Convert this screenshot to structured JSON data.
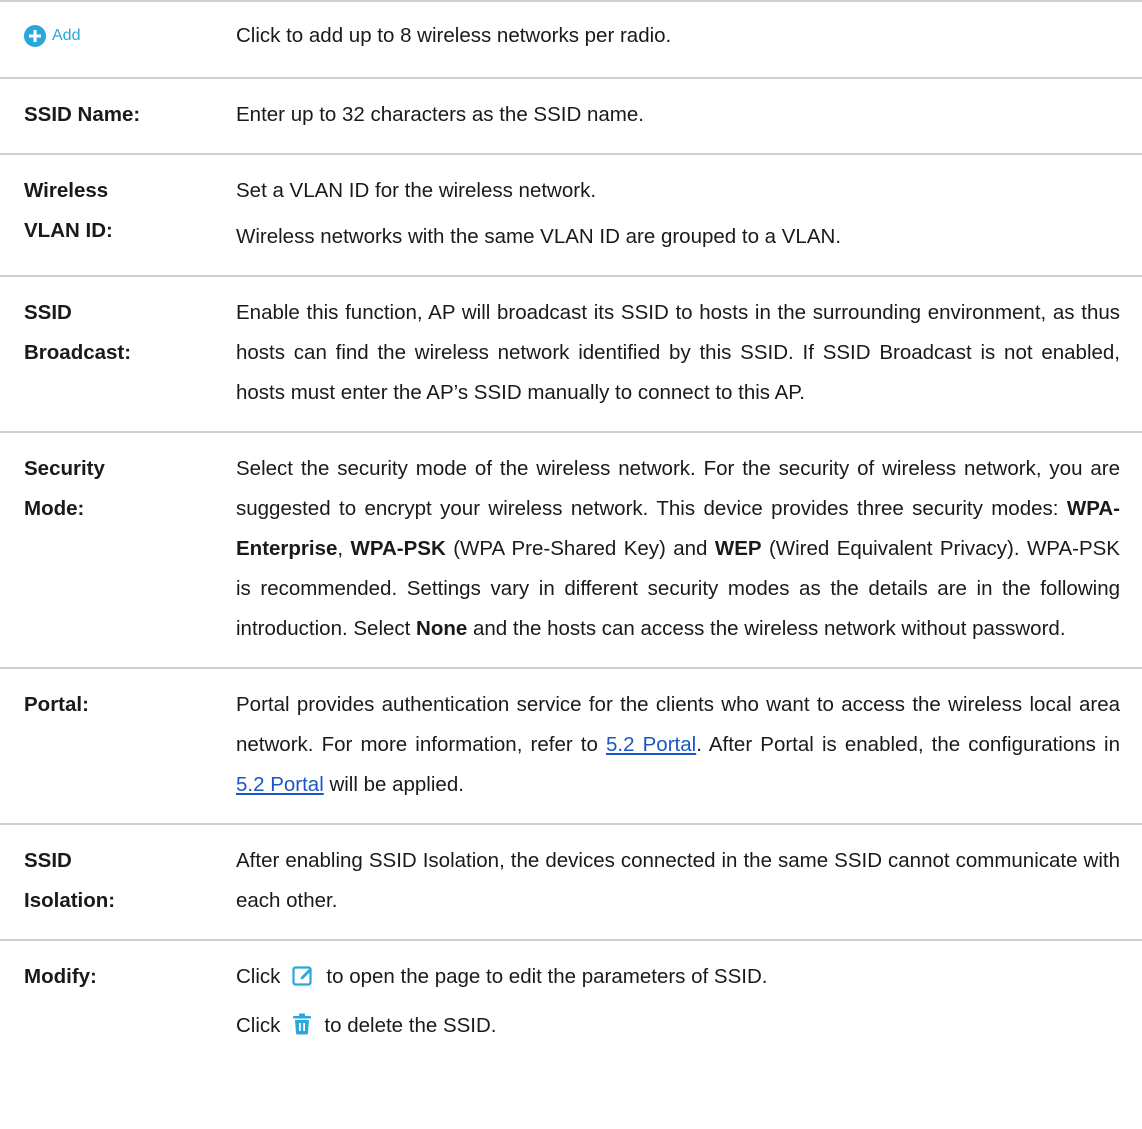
{
  "rows": {
    "add": {
      "button_label": "Add",
      "desc": "Click to add up to 8 wireless networks per radio."
    },
    "ssid_name": {
      "term": "SSID Name:",
      "desc": "Enter up to 32 characters as the SSID name."
    },
    "vlan": {
      "term_line1": "Wireless",
      "term_line2": "VLAN ID:",
      "desc1": "Set a VLAN ID for the wireless network.",
      "desc2": "Wireless networks with the same VLAN ID are grouped to a VLAN."
    },
    "broadcast": {
      "term_line1": "SSID",
      "term_line2": "Broadcast:",
      "desc": "Enable this function, AP will broadcast its SSID to hosts in the surrounding environment, as thus hosts can find the wireless network identified by this SSID. If SSID Broadcast is not enabled, hosts must enter the AP’s SSID manually to connect to this AP."
    },
    "security": {
      "term_line1": "Security",
      "term_line2": "Mode:",
      "desc_a": "Select the security mode of the wireless network. For the security of wireless network, you are suggested to encrypt your wireless network. This device provides three security modes: ",
      "mode1": "WPA-Enterprise",
      "sep1": ", ",
      "mode2": "WPA-PSK",
      "desc_b": " (WPA Pre-Shared Key) and ",
      "mode3": "WEP",
      "desc_c": " (Wired Equivalent Privacy). WPA-PSK is recommended. Settings vary in different security modes as the details are in the following introduction. Select ",
      "mode_none": "None",
      "desc_d": " and the hosts can access the wireless network without password."
    },
    "portal": {
      "term": "Portal:",
      "desc_a": "Portal provides authentication service for the clients who want to access the wireless local area network. For more information, refer to ",
      "link1": "5.2 Portal",
      "desc_b": ". After Portal is enabled, the configurations in ",
      "link2": "5.2 Portal",
      "desc_c": " will be applied."
    },
    "isolation": {
      "term_line1": "SSID",
      "term_line2": "Isolation:",
      "desc": "After enabling SSID Isolation, the devices connected in the same SSID cannot communicate with each other."
    },
    "modify": {
      "term": "Modify:",
      "line1_pre": "Click",
      "line1_post": "to open the page to edit the parameters of SSID.",
      "line2_pre": "Click",
      "line2_post": "to delete the SSID.",
      "edit_icon": "edit-icon",
      "delete_icon": "trash-icon"
    }
  },
  "colors": {
    "accent": "#2aa6dc",
    "link": "#1a56c6",
    "divider": "#cfcfcf"
  }
}
